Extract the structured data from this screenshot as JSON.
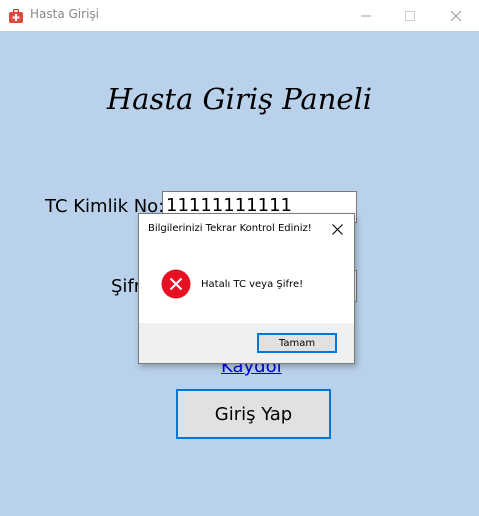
{
  "window": {
    "title": "Hasta Girişi",
    "icon": "first-aid-kit-icon"
  },
  "form": {
    "heading": "Hasta Giriş Paneli",
    "tc_label": "TC Kimlik No:",
    "tc_value": "11111111111",
    "password_label": "Şifre:",
    "password_value": "",
    "register_link": "Kaydol",
    "login_button": "Giriş Yap"
  },
  "dialog": {
    "title": "Bilgilerinizi Tekrar Kontrol Ediniz!",
    "icon": "error-icon",
    "message": "Hatalı TC veya Şifre!",
    "ok_button": "Tamam"
  },
  "colors": {
    "window_background": "#b9d1ea",
    "focus_border": "#0078d7",
    "error_red": "#e81123",
    "link": "#0000ee"
  }
}
